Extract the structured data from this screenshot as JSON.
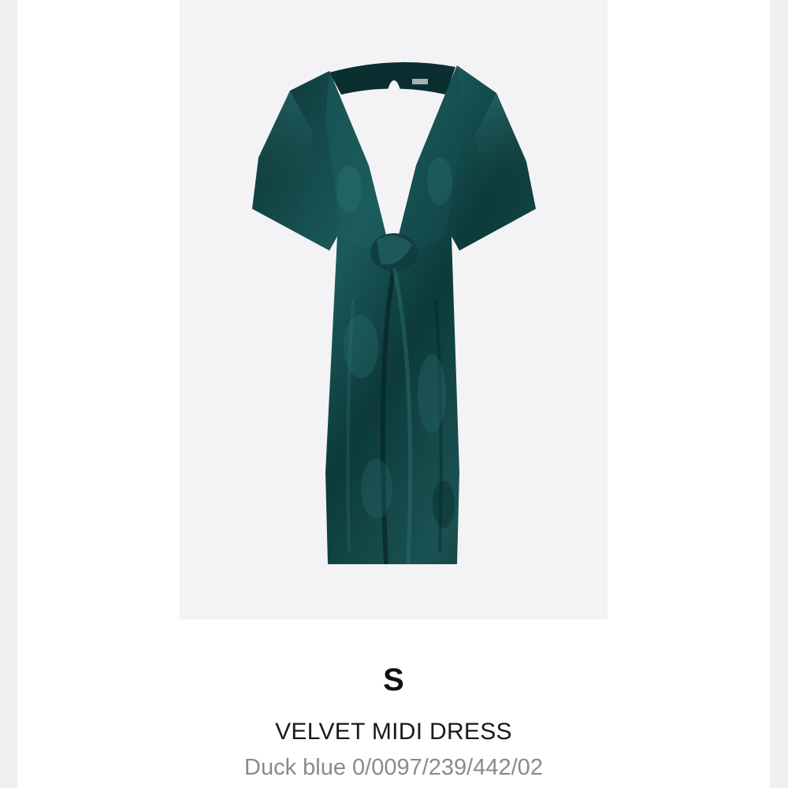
{
  "product": {
    "image_icon": "dress-image",
    "dress_color": "#0f3f40",
    "size": "S",
    "name": "VELVET MIDI DRESS",
    "color_and_ref": "Duck blue 0/0097/239/442/02"
  }
}
